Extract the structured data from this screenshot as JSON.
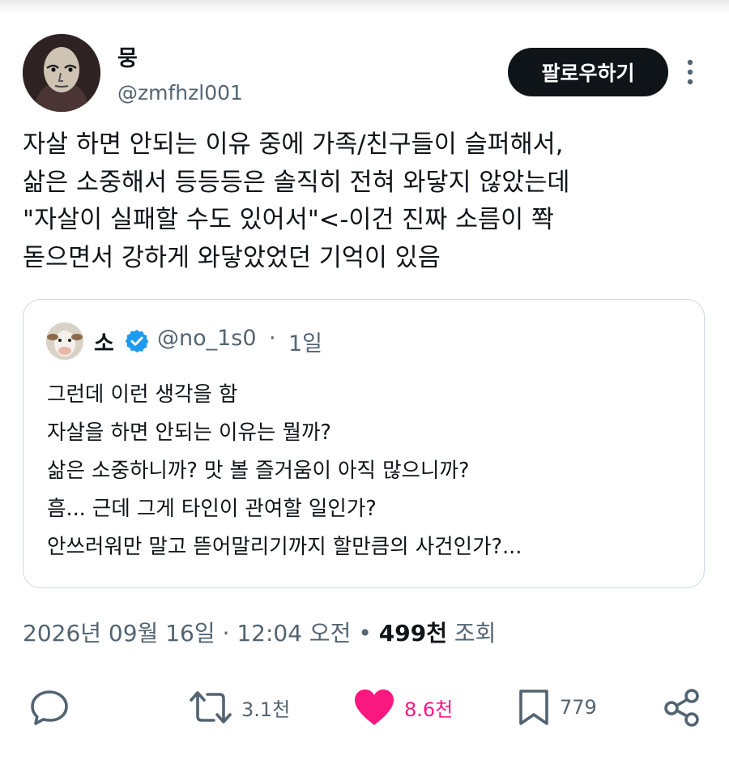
{
  "author": {
    "name": "뭉",
    "handle": "@zmfhzl001"
  },
  "follow_label": "팔로우하기",
  "tweet_text": "자살 하면 안되는 이유 중에 가족/친구들이 슬퍼해서,\n삶은 소중해서 등등등은 솔직히 전혀 와닿지 않았는데\n\"자살이 실패할 수도 있어서\"<-이건 진짜 소름이 쫙\n돋으면서 강하게 와닿았었던 기억이 있음",
  "quote": {
    "name": "소",
    "handle": "@no_1s0",
    "separator": "·",
    "time": "1일",
    "text": "그런데 이런 생각을 함\n자살을 하면 안되는 이유는 뭘까?\n삶은 소중하니까? 맛 볼 즐거움이 아직 많으니까?\n흠... 근데 그게 타인이 관여할 일인가?\n안쓰러워만 말고 뜯어말리기까지 할만큼의 사건인가?..."
  },
  "meta": {
    "date": "2026년 09월 16일",
    "sep1": " · ",
    "time": "12:04 오전",
    "sep2": " • ",
    "views": "499천",
    "views_label": " 조회"
  },
  "actions": {
    "retweets": "3.1천",
    "likes": "8.6천",
    "bookmarks": "779"
  },
  "colors": {
    "like": "#f91880",
    "verified": "#1d9bf0",
    "muted": "#536471",
    "button": "#0f1419"
  }
}
